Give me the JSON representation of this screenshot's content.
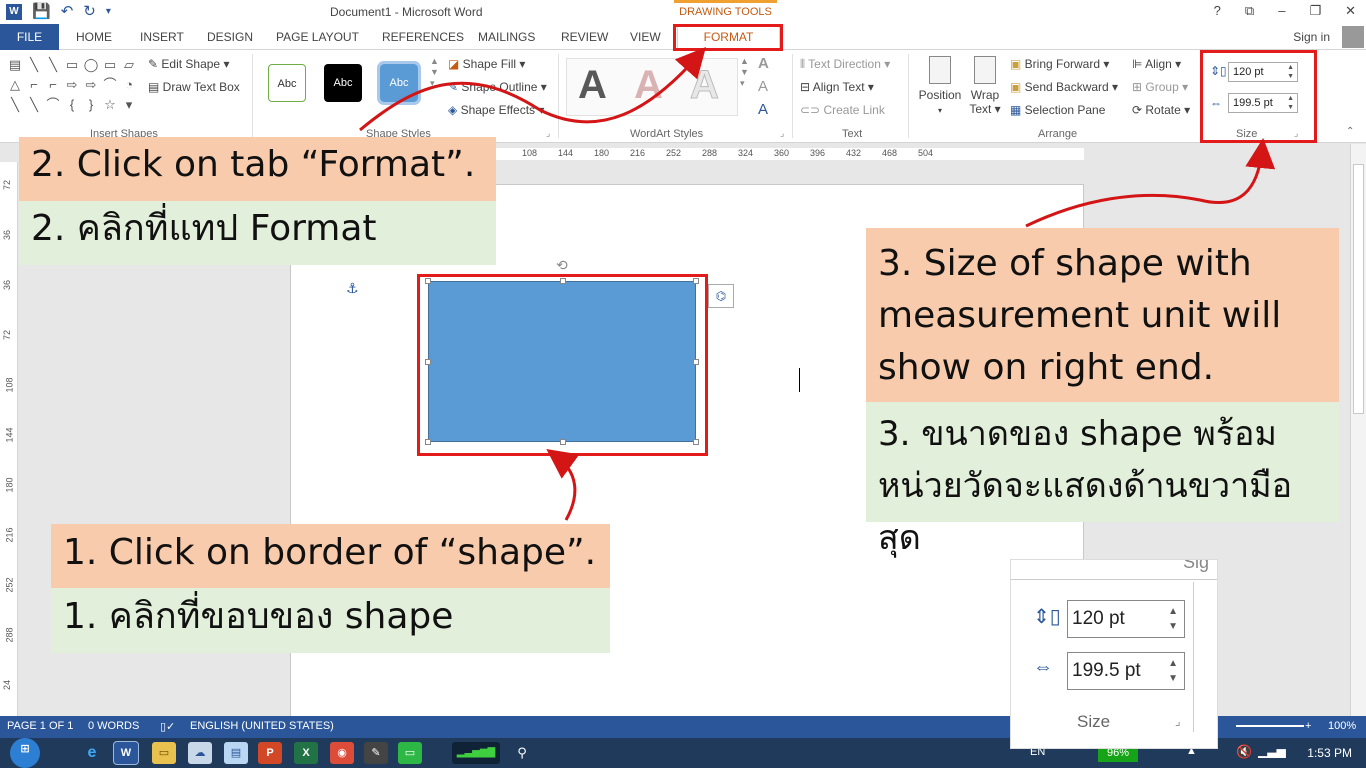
{
  "window": {
    "title": "Document1 - Microsoft Word",
    "contextual_tab_group": "DRAWING TOOLS",
    "controls": [
      "?",
      "⧉",
      "–",
      "❐",
      "✕"
    ]
  },
  "tabs": {
    "file": "FILE",
    "items": [
      "HOME",
      "INSERT",
      "DESIGN",
      "PAGE LAYOUT",
      "REFERENCES",
      "MAILINGS",
      "REVIEW",
      "VIEW"
    ],
    "format": "FORMAT",
    "sign_in": "Sign in"
  },
  "ribbon": {
    "insert_shapes": {
      "label": "Insert Shapes",
      "edit_shape": "Edit Shape",
      "draw_text_box": "Draw Text Box",
      "glyphs": [
        "▤",
        "╲",
        "╲",
        "▭",
        "◯",
        "▭",
        "▱",
        "△",
        "⌐",
        "⌐",
        "⇨",
        "⇨",
        "⌒",
        "◔",
        "╲",
        "╲",
        "⌒",
        "{",
        "}",
        "☆",
        "▾"
      ]
    },
    "shape_styles": {
      "label": "Shape Styles",
      "styles": [
        "Abc",
        "Abc",
        "Abc"
      ],
      "shape_fill": "Shape Fill",
      "shape_outline": "Shape Outline",
      "shape_effects": "Shape Effects"
    },
    "wordart": {
      "label": "WordArt Styles",
      "letters": [
        "A",
        "A",
        "A"
      ],
      "small": [
        "A",
        "A",
        "A"
      ]
    },
    "text": {
      "label": "Text",
      "text_direction": "Text Direction",
      "align_text": "Align Text",
      "create_link": "Create Link"
    },
    "arrange": {
      "label": "Arrange",
      "position": "Position",
      "wrap_text_1": "Wrap",
      "wrap_text_2": "Text",
      "bring_forward": "Bring Forward",
      "send_backward": "Send Backward",
      "selection_pane": "Selection Pane",
      "align": "Align",
      "group": "Group",
      "rotate": "Rotate"
    },
    "size": {
      "label": "Size",
      "height": "120 pt",
      "width": "199.5 pt"
    }
  },
  "ruler": {
    "h_ticks": [
      "108",
      "144",
      "180",
      "216",
      "252",
      "288",
      "324",
      "360",
      "396",
      "432",
      "468",
      "504"
    ],
    "v_ticks": [
      "72",
      "36",
      "36",
      "72",
      "108",
      "144",
      "180",
      "216",
      "252",
      "288",
      "24"
    ]
  },
  "statusbar": {
    "page": "PAGE 1 OF 1",
    "words": "0 WORDS",
    "language": "ENGLISH (UNITED STATES)",
    "zoom": "100%"
  },
  "taskbar": {
    "battery": "96%",
    "lang": "EN",
    "time": "1:53 PM"
  },
  "callouts": {
    "step2_en": "2. Click on tab “Format”.",
    "step2_th": "2. คลิกที่แทป Format",
    "step3_en": "3. Size of shape with measurement unit will show on right end.",
    "step3_th": "3. ขนาดของ shape พร้อมหน่วยวัดจะแสดงด้านขวามือสุด",
    "step1_en": "1. Click on border of “shape”.",
    "step1_th": "1. คลิกที่ขอบของ shape"
  },
  "zoom_inset": {
    "height": "120 pt",
    "width": "199.5 pt",
    "label": "Size",
    "top_fragment": "Sig"
  }
}
